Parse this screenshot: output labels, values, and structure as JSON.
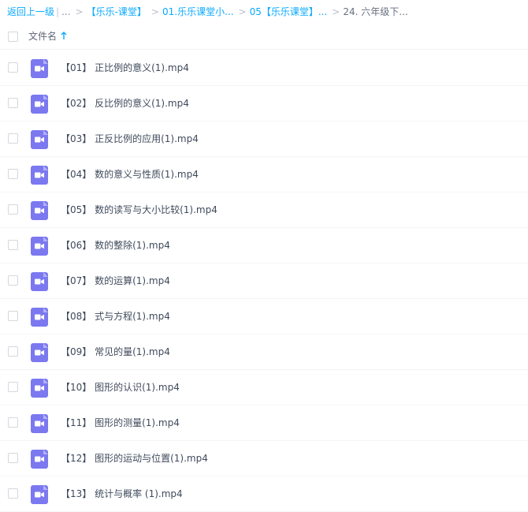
{
  "breadcrumb": {
    "back_label": "返回上一级",
    "separator": "|",
    "ellipsis": "...",
    "items": [
      {
        "label": "【乐乐-课堂】"
      },
      {
        "label": "01.乐乐课堂小..."
      },
      {
        "label": "05【乐乐课堂】..."
      }
    ],
    "current": "24. 六年级下..."
  },
  "header": {
    "name_column": "文件名",
    "sort_direction": "up"
  },
  "colors": {
    "link": "#09aaff",
    "video_icon": "#7b78f0"
  },
  "files": [
    {
      "name": "【01】 正比例的意义(1).mp4",
      "icon": "video-file-icon"
    },
    {
      "name": "【02】 反比例的意义(1).mp4",
      "icon": "video-file-icon"
    },
    {
      "name": "【03】 正反比例的应用(1).mp4",
      "icon": "video-file-icon"
    },
    {
      "name": "【04】 数的意义与性质(1).mp4",
      "icon": "video-file-icon"
    },
    {
      "name": "【05】 数的读写与大小比较(1).mp4",
      "icon": "video-file-icon"
    },
    {
      "name": "【06】 数的整除(1).mp4",
      "icon": "video-file-icon"
    },
    {
      "name": "【07】 数的运算(1).mp4",
      "icon": "video-file-icon"
    },
    {
      "name": "【08】 式与方程(1).mp4",
      "icon": "video-file-icon"
    },
    {
      "name": "【09】 常见的量(1).mp4",
      "icon": "video-file-icon"
    },
    {
      "name": "【10】 图形的认识(1).mp4",
      "icon": "video-file-icon"
    },
    {
      "name": "【11】 图形的测量(1).mp4",
      "icon": "video-file-icon"
    },
    {
      "name": "【12】 图形的运动与位置(1).mp4",
      "icon": "video-file-icon"
    },
    {
      "name": "【13】 统计与概率 (1).mp4",
      "icon": "video-file-icon"
    }
  ]
}
